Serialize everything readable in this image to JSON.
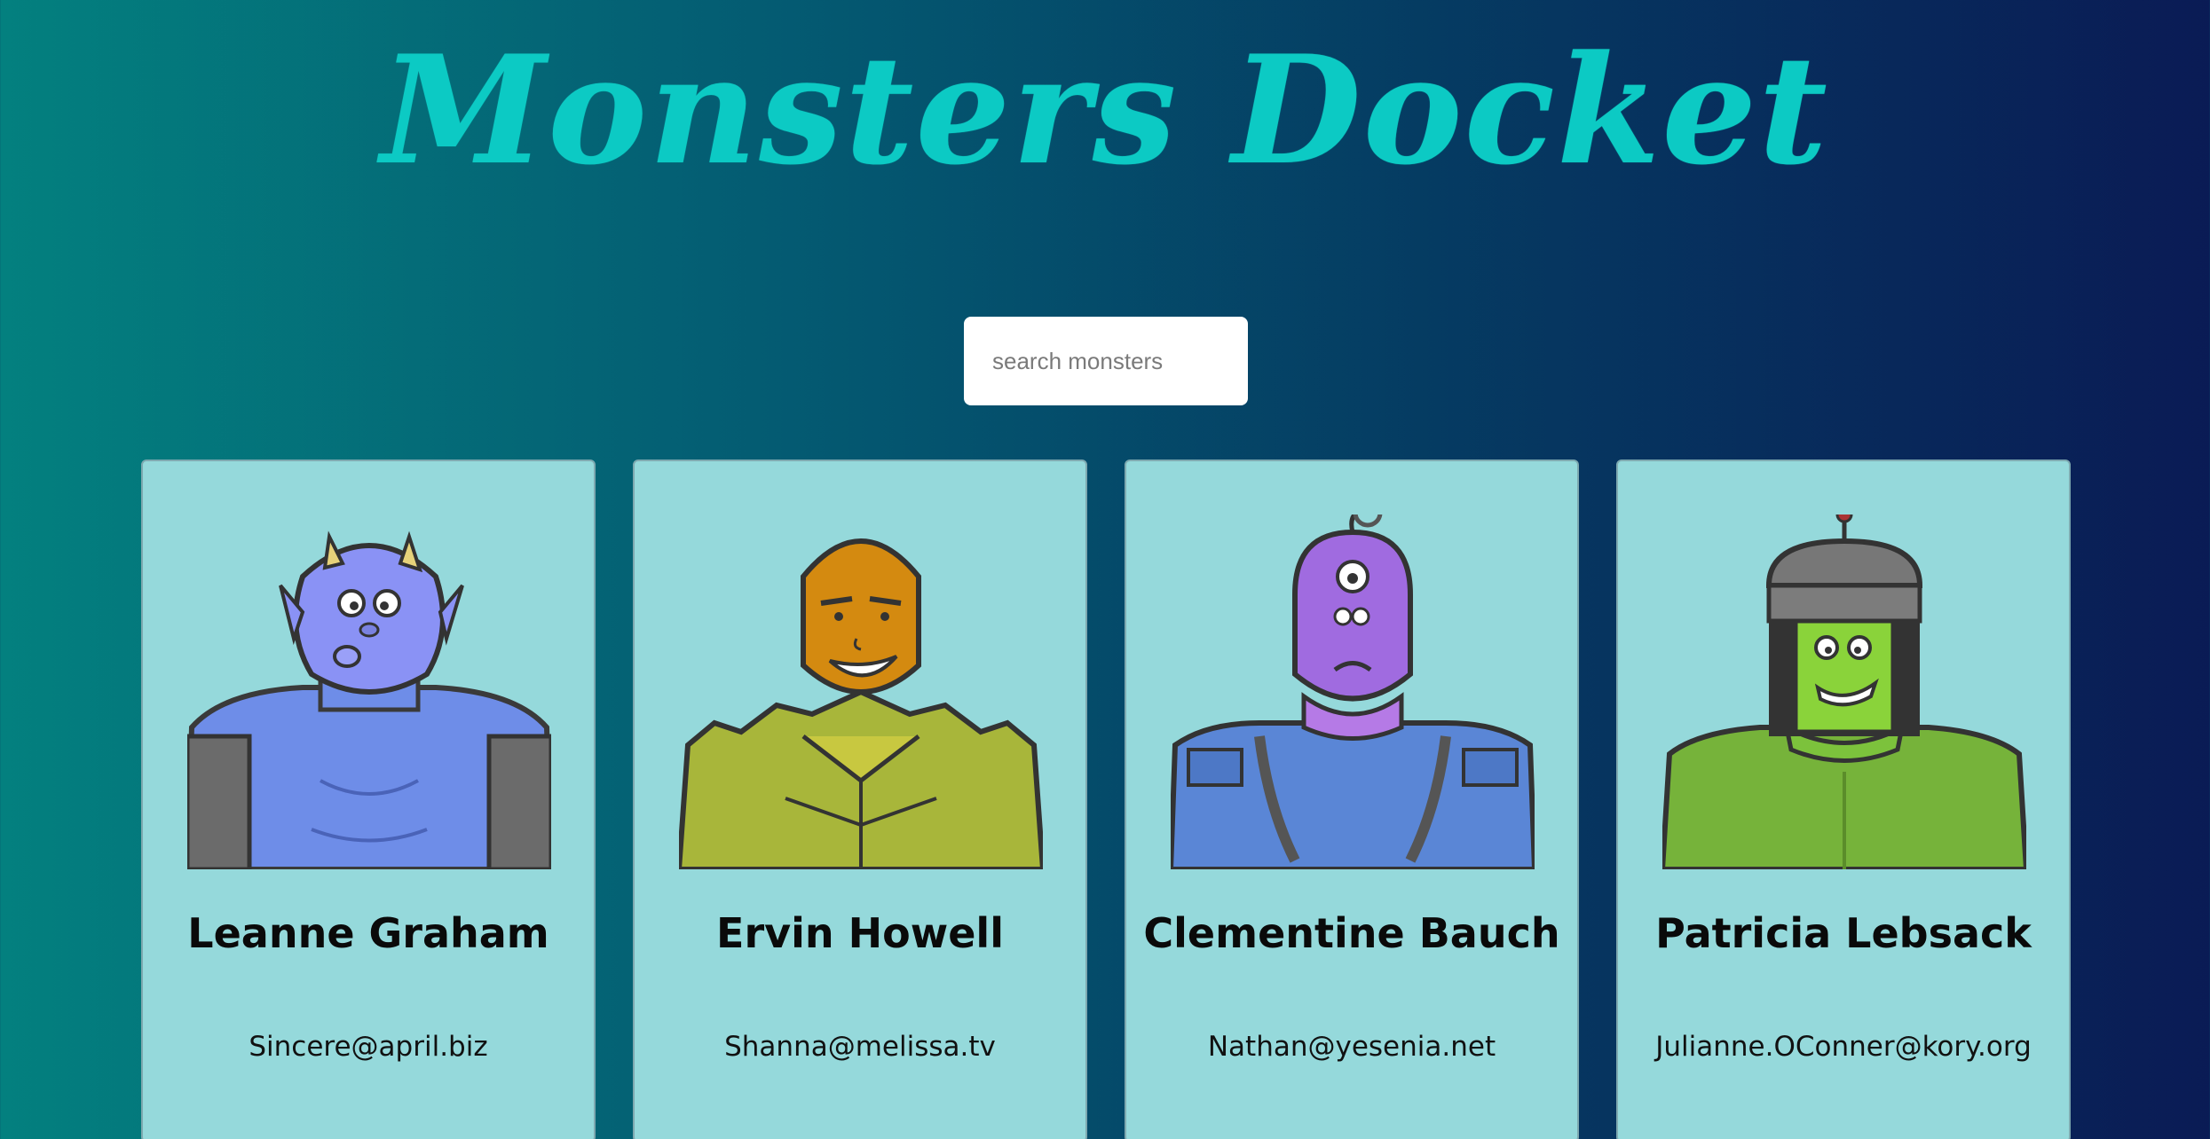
{
  "header": {
    "title": "Monsters Docket"
  },
  "search": {
    "placeholder": "search monsters",
    "value": ""
  },
  "colors": {
    "accent": "#0ccac4",
    "card_bg": "#95d9db"
  },
  "monsters": [
    {
      "name": "Leanne Graham",
      "email": "Sincere@april.biz",
      "avatar": "blue-horned-monster-icon"
    },
    {
      "name": "Ervin Howell",
      "email": "Shanna@melissa.tv",
      "avatar": "orange-spiky-monster-icon"
    },
    {
      "name": "Clementine Bauch",
      "email": "Nathan@yesenia.net",
      "avatar": "purple-cyclops-monster-icon"
    },
    {
      "name": "Patricia Lebsack",
      "email": "Julianne.OConner@kory.org",
      "avatar": "green-robot-monster-icon"
    }
  ]
}
